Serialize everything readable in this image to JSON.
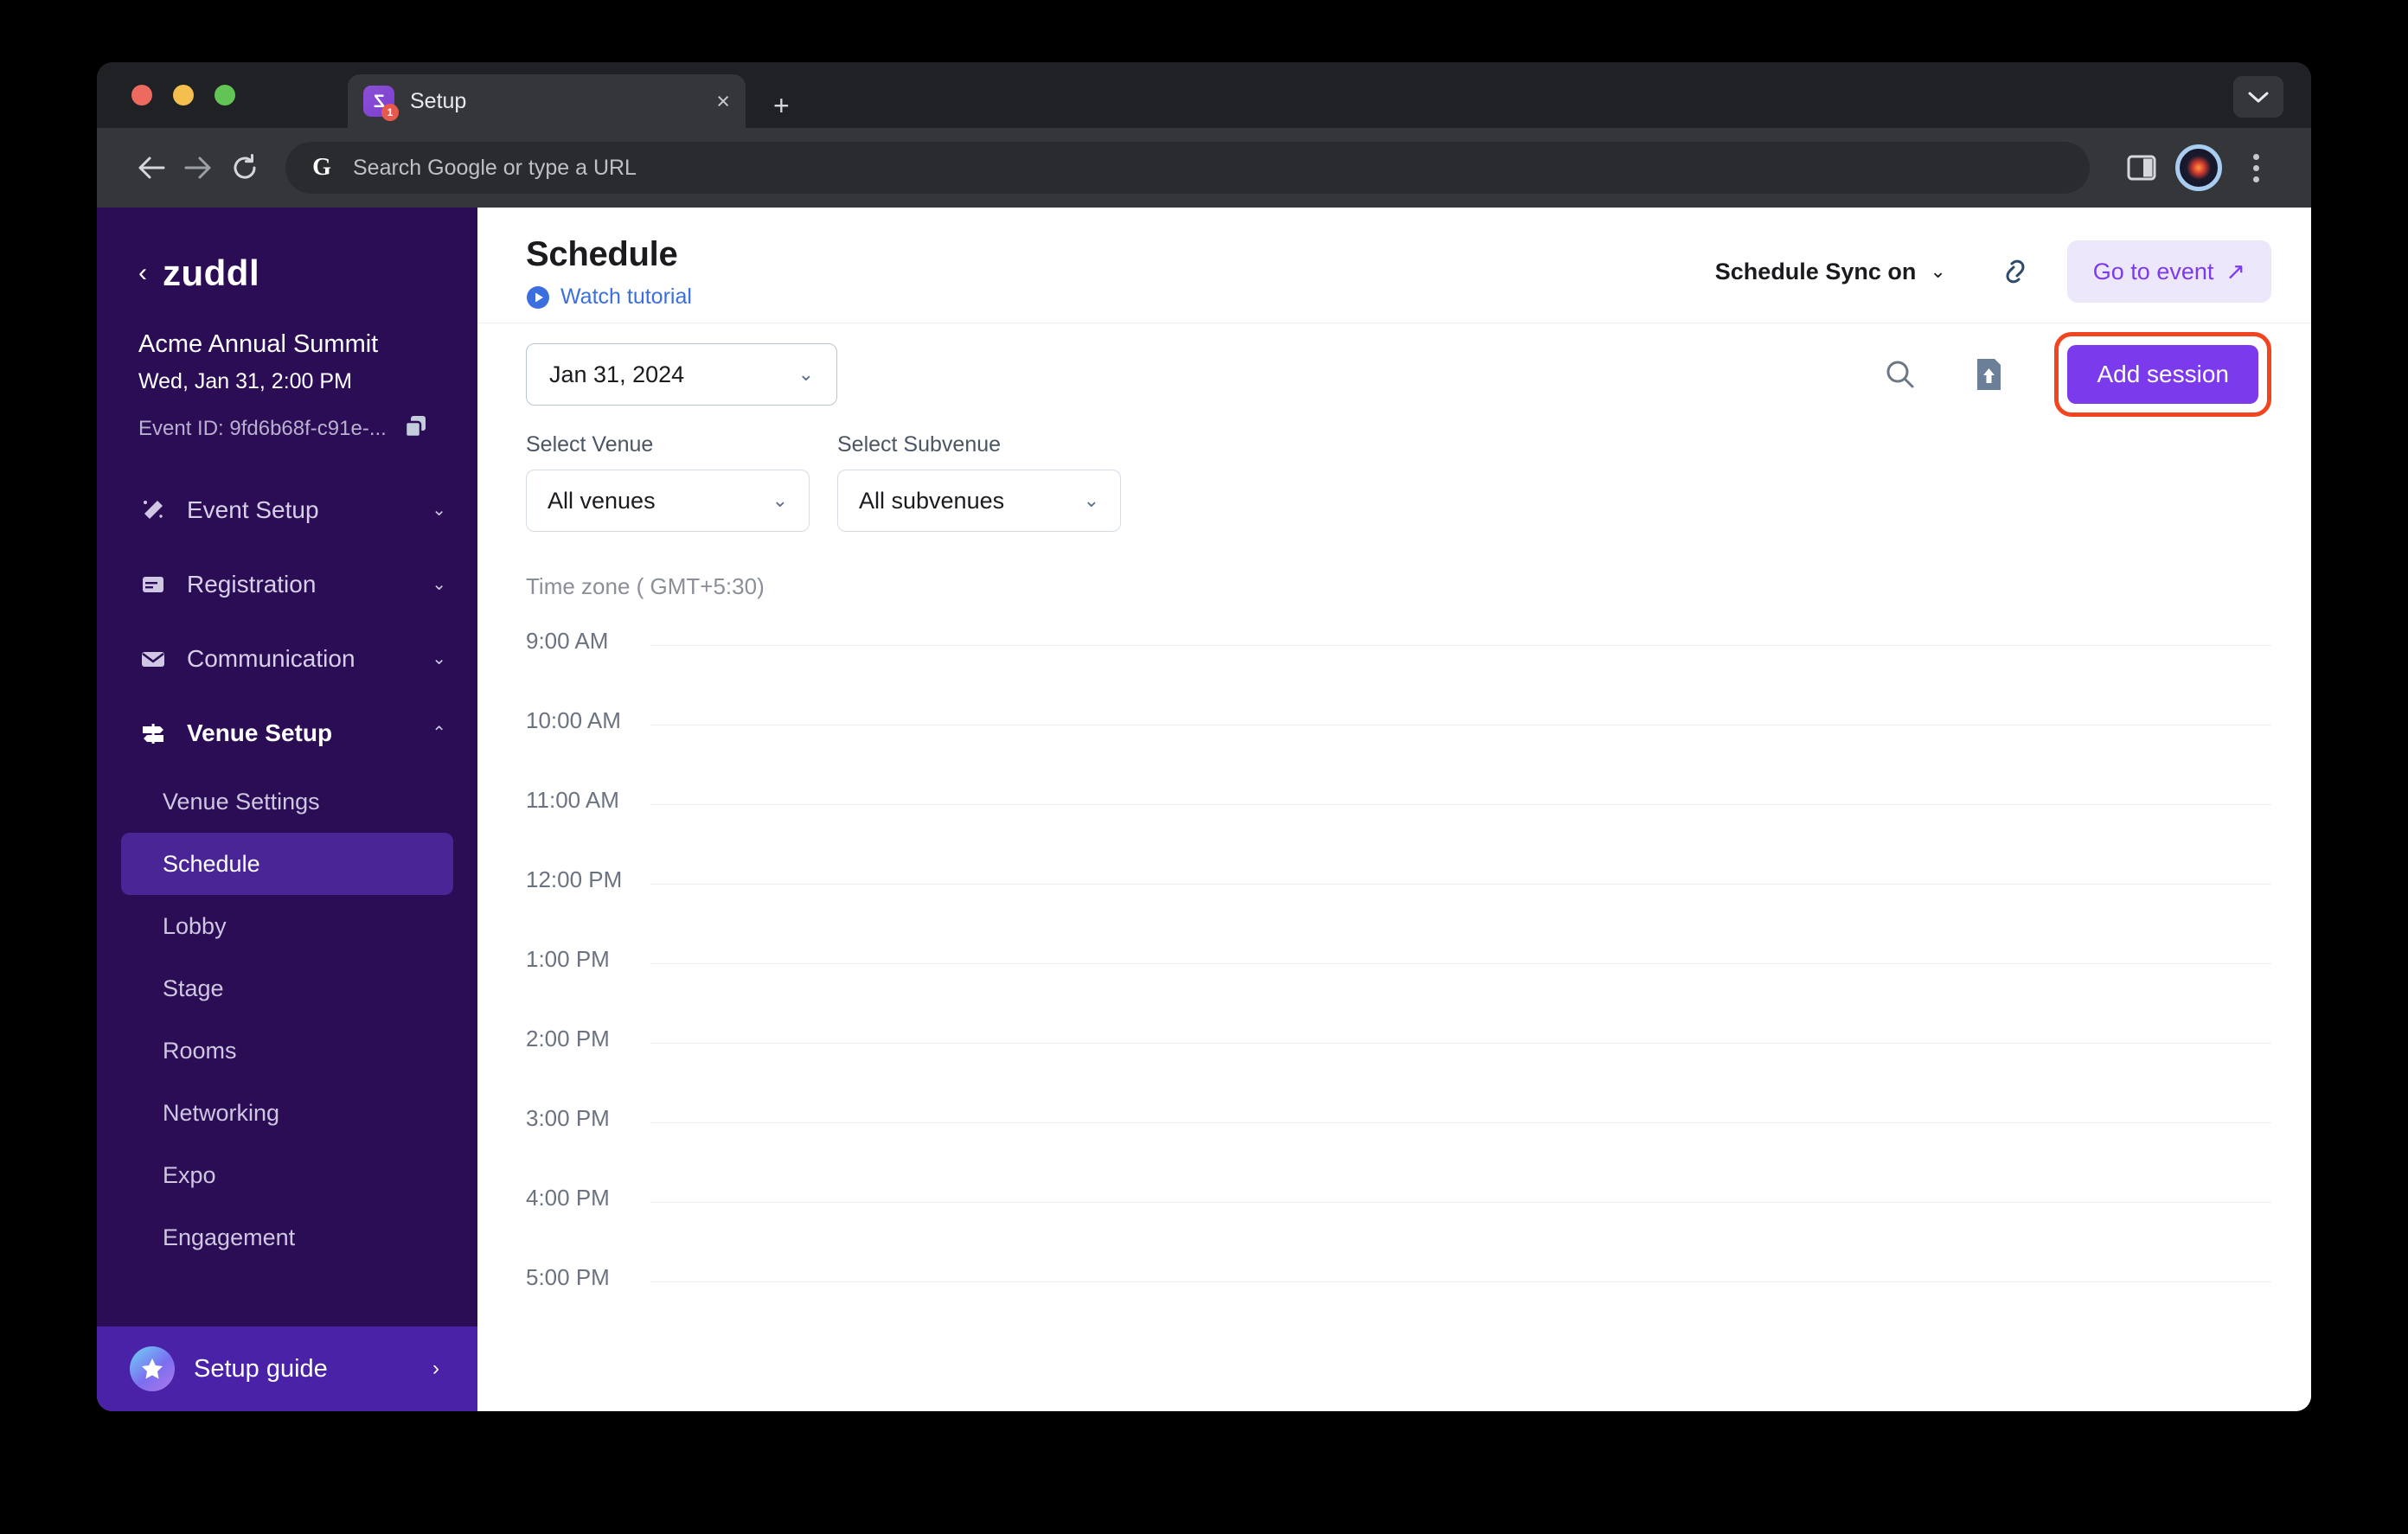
{
  "browser": {
    "tab": {
      "title": "Setup",
      "favicon_badge": "1",
      "close_label": "×"
    },
    "new_tab_label": "+",
    "omnibox_placeholder": "Search Google or type a URL",
    "icons": {
      "back": "back-arrow-icon",
      "forward": "forward-arrow-icon",
      "reload": "reload-icon",
      "google": "G",
      "side_panel": "side-panel-icon",
      "profile": "profile-avatar",
      "menu": "three-dot-menu-icon",
      "tab_list": "chevron-down-icon"
    }
  },
  "sidebar": {
    "brand": {
      "back": "‹",
      "name": "zuddl"
    },
    "event": {
      "name": "Acme Annual Summit",
      "datetime": "Wed, Jan 31, 2:00 PM",
      "event_id": "Event ID: 9fd6b68f-c91e-...",
      "copy_icon": "copy-icon"
    },
    "groups": [
      {
        "label": "Event Setup",
        "icon": "magic-wand-icon",
        "expanded": false,
        "chevron": "⌄"
      },
      {
        "label": "Registration",
        "icon": "form-icon",
        "expanded": false,
        "chevron": "⌄"
      },
      {
        "label": "Communication",
        "icon": "envelope-icon",
        "expanded": false,
        "chevron": "⌄"
      },
      {
        "label": "Venue Setup",
        "icon": "signpost-icon",
        "expanded": true,
        "chevron": "⌃"
      }
    ],
    "venue_setup_items": [
      {
        "label": "Venue Settings",
        "selected": false
      },
      {
        "label": "Schedule",
        "selected": true
      },
      {
        "label": "Lobby",
        "selected": false
      },
      {
        "label": "Stage",
        "selected": false
      },
      {
        "label": "Rooms",
        "selected": false
      },
      {
        "label": "Networking",
        "selected": false
      },
      {
        "label": "Expo",
        "selected": false
      },
      {
        "label": "Engagement",
        "selected": false
      }
    ],
    "setup_guide": {
      "label": "Setup guide",
      "icon": "star-icon",
      "chevron": "›"
    }
  },
  "header": {
    "title": "Schedule",
    "watch_tutorial": "Watch tutorial",
    "watch_tutorial_icon": "play-circle-icon",
    "schedule_sync": "Schedule Sync on",
    "schedule_sync_chevron": "⌄",
    "link_icon": "link-icon",
    "go_to_event": "Go to event",
    "go_to_event_icon": "↗"
  },
  "toolbar": {
    "date_value": "Jan 31, 2024",
    "date_chevron": "⌄",
    "search_icon": "search-icon",
    "export_icon": "export-upload-icon",
    "add_session_label": "Add session"
  },
  "filters": {
    "venue": {
      "label": "Select Venue",
      "value": "All venues",
      "chevron": "⌄"
    },
    "subvenue": {
      "label": "Select Subvenue",
      "value": "All subvenues",
      "chevron": "⌄"
    }
  },
  "schedule": {
    "timezone": "Time zone ( GMT+5:30)",
    "times": [
      "9:00 AM",
      "10:00 AM",
      "11:00 AM",
      "12:00 PM",
      "1:00 PM",
      "2:00 PM",
      "3:00 PM",
      "4:00 PM",
      "5:00 PM"
    ]
  },
  "colors": {
    "sidebar_bg": "#2b0d55",
    "sidebar_selected": "#4a2596",
    "setup_guide_bg": "#4a22a8",
    "accent_purple": "#7c3aed",
    "highlight_outline": "#f1441f",
    "link_blue": "#3b6fe0"
  }
}
